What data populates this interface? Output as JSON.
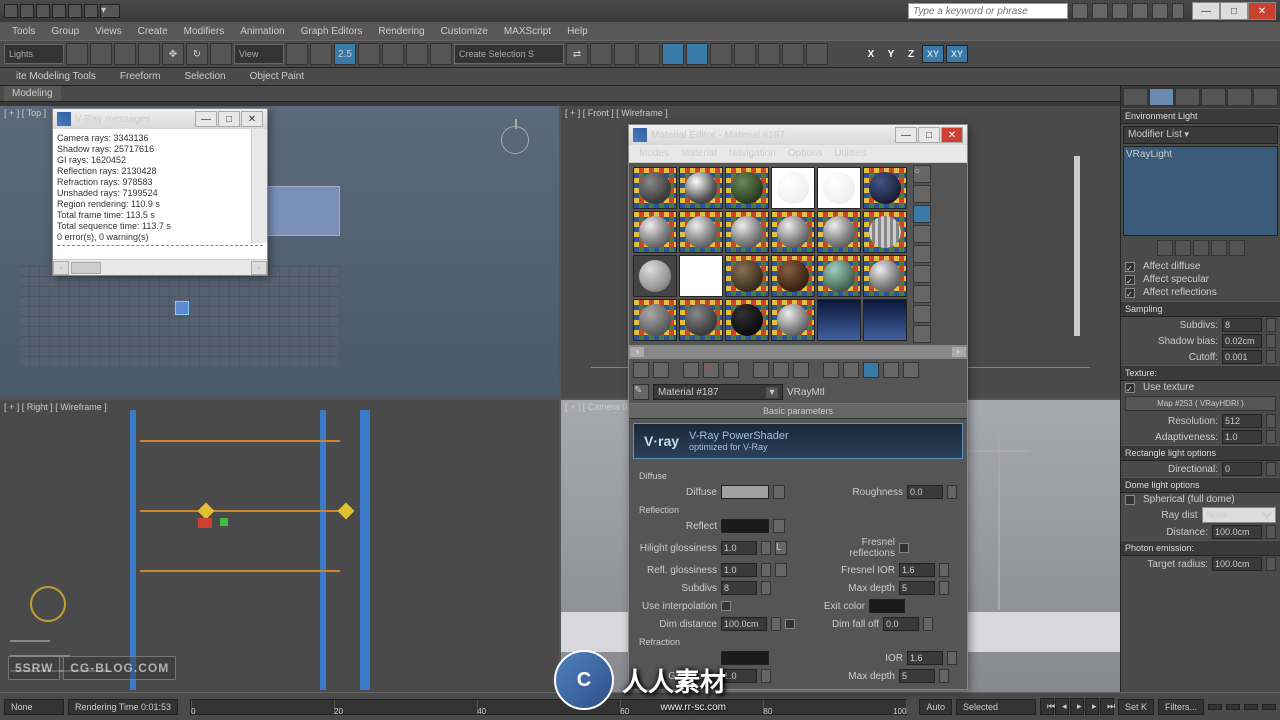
{
  "titlebar": {
    "search_placeholder": "Type a keyword or phrase"
  },
  "menu": [
    "Tools",
    "Group",
    "Views",
    "Create",
    "Modifiers",
    "Animation",
    "Graph Editors",
    "Rendering",
    "Customize",
    "MAXScript",
    "Help"
  ],
  "toolbar": {
    "lights_dd": "Lights",
    "view_dd": "View",
    "create_sel": "Create Selection S",
    "axes": [
      "X",
      "Y",
      "Z"
    ],
    "xy1": "XY",
    "xy2": "XY"
  },
  "ribbon": {
    "tab": "Modeling",
    "items": [
      "ite Modeling Tools",
      "Freeform",
      "Selection",
      "Object Paint"
    ]
  },
  "viewports": {
    "top": "[ + ] [ Top ]",
    "front": "[ + ] [ Front ] [ Wireframe ]",
    "right": "[ + ] [ Right ] [ Wireframe ]",
    "camera": "[ + ] [ Camera 0"
  },
  "vray_window": {
    "title": "V-Ray messages",
    "lines": [
      "Camera rays: 3343136",
      "Shadow rays: 25717616",
      "GI rays: 1620452",
      "Reflection rays: 2130428",
      "Refraction rays: 978583",
      "Unshaded rays: 7199524",
      "Region rendering: 110.9 s",
      "Total frame time: 113.5 s",
      "Total sequence time: 113.7 s",
      "0 error(s), 0 warning(s)"
    ]
  },
  "material_editor": {
    "title": "Material Editor - Material #187",
    "menu": [
      "Modes",
      "Material",
      "Navigation",
      "Options",
      "Utilities"
    ],
    "name": "Material #187",
    "type": "VRayMtl",
    "rollup_basic": "Basic parameters",
    "vray_logo": "V·ray",
    "vray_sub1": "V-Ray PowerShader",
    "vray_sub2": "optimized for V-Ray",
    "diffuse_grp": "Diffuse",
    "diffuse_lbl": "Diffuse",
    "roughness_lbl": "Roughness",
    "roughness_val": "0.0",
    "reflection_grp": "Reflection",
    "reflect_lbl": "Reflect",
    "hlight_gloss_lbl": "Hilight glossiness",
    "hlight_gloss_val": "1.0",
    "refl_gloss_lbl": "Refl. glossiness",
    "refl_gloss_val": "1.0",
    "fresnel_lbl": "Fresnel reflections",
    "fresnel_ior_lbl": "Fresnel IOR",
    "fresnel_ior_val": "1.6",
    "subdivs_lbl": "Subdivs",
    "subdivs_val": "8",
    "max_depth_lbl": "Max depth",
    "max_depth_val": "5",
    "use_interp_lbl": "Use interpolation",
    "exit_color_lbl": "Exit color",
    "dim_dist_lbl": "Dim distance",
    "dim_dist_val": "100.0cm",
    "dim_falloff_lbl": "Dim fall off",
    "dim_falloff_val": "0.0",
    "refraction_grp": "Refraction",
    "ior_lbl": "IOR",
    "ior_val": "1.6",
    "glossiness_lbl": "Glossiness",
    "glossiness_val": "1.0",
    "max_depth2_lbl": "Max depth",
    "max_depth2_val": "5"
  },
  "cmdpanel": {
    "env_light": "Environment Light",
    "mod_list": "Modifier List",
    "mod_item": "VRayLight",
    "affect_diffuse": "Affect diffuse",
    "affect_specular": "Affect specular",
    "affect_reflections": "Affect reflections",
    "sampling": "Sampling",
    "subdivs_lbl": "Subdivs:",
    "subdivs_val": "8",
    "shadow_bias_lbl": "Shadow bias:",
    "shadow_bias_val": "0.02cm",
    "cutoff_lbl": "Cutoff:",
    "cutoff_val": "0.001",
    "texture": "Texture:",
    "use_texture": "Use texture",
    "map_lbl": "Map #253  ( VRayHDRI )",
    "resolution_lbl": "Resolution:",
    "resolution_val": "512",
    "adaptiveness_lbl": "Adaptiveness:",
    "adaptiveness_val": "1.0",
    "rect_opts": "Rectangle light options",
    "directional_lbl": "Directional:",
    "directional_val": "0",
    "dome_opts": "Dome light options",
    "spherical": "Spherical (full dome)",
    "ray_dist_lbl": "Ray dist",
    "ray_dist_val": "None",
    "distance_lbl": "Distance:",
    "distance_val": "100.0cm",
    "photon": "Photon emission:",
    "target_radius_lbl": "Target radius:",
    "target_radius_val": "100.0cm"
  },
  "statusbar": {
    "none": "None",
    "rend_time": "Rendering Time  0:01:53",
    "ticks": [
      "0",
      "20",
      "40",
      "60",
      "80",
      "100"
    ],
    "auto": "Auto",
    "selected": "Selected",
    "setk": "Set K",
    "filters": "Filters..."
  },
  "watermark": {
    "badge1": "5SRW",
    "badge2": "CG-BLOG.COM",
    "big_text": "人人素材",
    "big_circle": "C",
    "big_url": "www.rr-sc.com"
  }
}
